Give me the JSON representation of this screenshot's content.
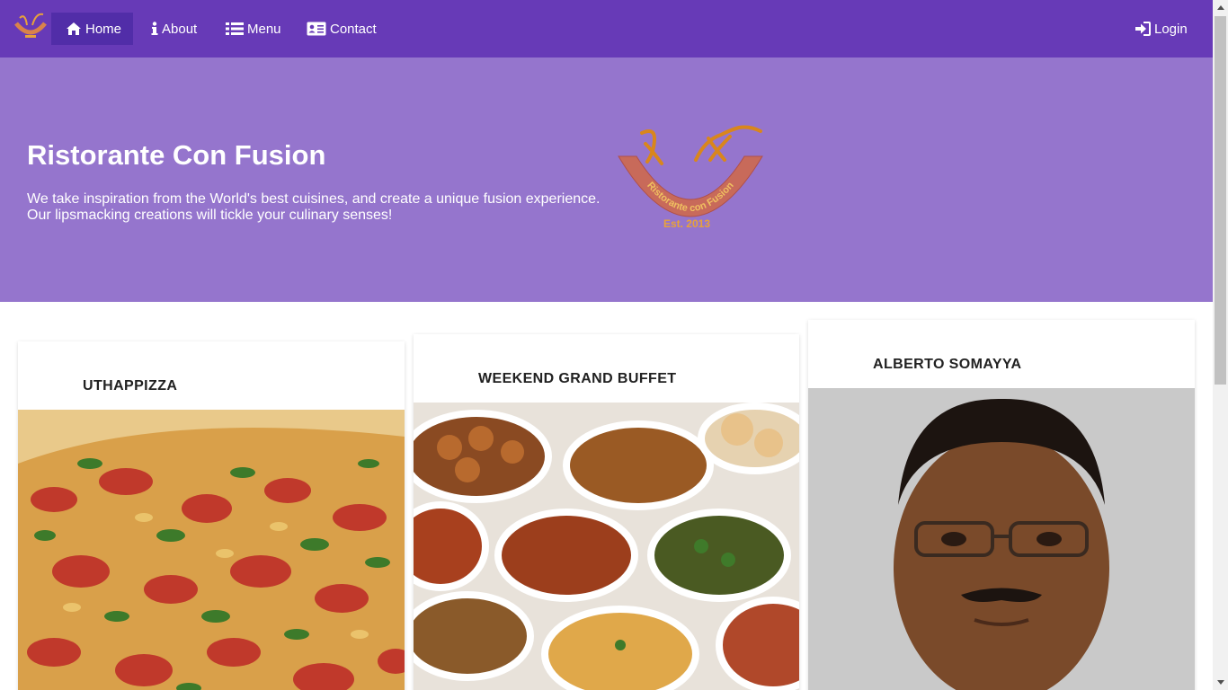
{
  "nav": {
    "brand_icon": "restaurant-logo",
    "items": [
      {
        "label": "Home",
        "icon": "home-icon",
        "active": true
      },
      {
        "label": "About",
        "icon": "info-icon"
      },
      {
        "label": "Menu",
        "icon": "list-icon"
      },
      {
        "label": "Contact",
        "icon": "address-card-icon"
      }
    ],
    "login": {
      "label": "Login",
      "icon": "sign-in-icon"
    }
  },
  "jumbotron": {
    "title": "Ristorante Con Fusion",
    "text_line1": "We take inspiration from the World's best cuisines, and create a unique fusion experience.",
    "text_line2": "Our lipsmacking creations will tickle your culinary senses!",
    "logo_text": "Ristorante con Fusion",
    "logo_est": "Est. 2013"
  },
  "cards": [
    {
      "title": "UTHAPPIZZA",
      "image": "pizza-photo"
    },
    {
      "title": "WEEKEND GRAND BUFFET",
      "image": "buffet-photo"
    },
    {
      "title": "ALBERTO SOMAYYA",
      "image": "person-photo"
    }
  ],
  "colors": {
    "navbar": "#673ab7",
    "nav_active": "#512da8",
    "jumbotron": "#9575cd",
    "logo_arc": "#c86a5a",
    "logo_gold": "#e8a23a"
  }
}
